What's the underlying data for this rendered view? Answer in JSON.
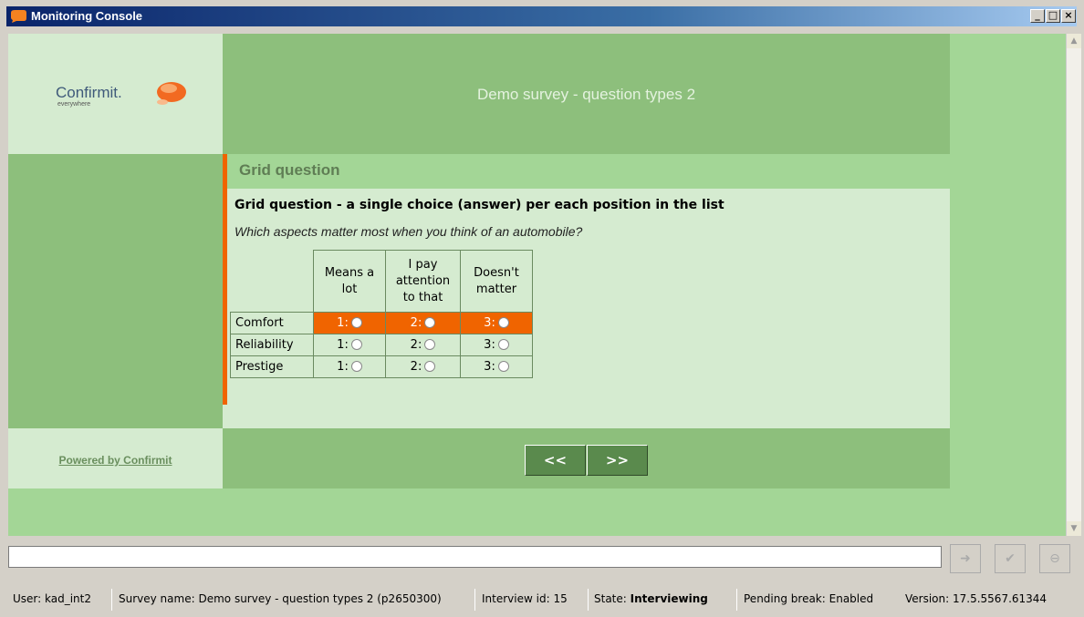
{
  "window": {
    "title": "Monitoring Console",
    "min_label": "_",
    "max_label": "□",
    "close_label": "×"
  },
  "survey": {
    "title": "Demo survey - question types 2",
    "logo_name": "Confirmit.",
    "logo_sub": "everywhere",
    "powered_by": "Powered by Confirmit",
    "question_heading": "Grid question",
    "question_text": "Grid question - a single choice (answer) per each position in the list",
    "question_instruction": "Which aspects matter most when you think of an automobile?",
    "columns": [
      "Means a lot",
      "I pay attention to that",
      "Doesn't matter"
    ],
    "rows": [
      {
        "label": "Comfort",
        "opts": [
          "1:",
          "2:",
          "3:"
        ],
        "highlighted": true
      },
      {
        "label": "Reliability",
        "opts": [
          "1:",
          "2:",
          "3:"
        ],
        "highlighted": false
      },
      {
        "label": "Prestige",
        "opts": [
          "1:",
          "2:",
          "3:"
        ],
        "highlighted": false
      }
    ],
    "prev_label": "<<",
    "next_label": ">>"
  },
  "command": {
    "input_value": ""
  },
  "status": {
    "user_label": "User:",
    "user": "kad_int2",
    "survey_label": "Survey name:",
    "survey_name": "Demo survey - question types 2 (p2650300)",
    "interview_label": "Interview id:",
    "interview_id": "15",
    "state_label": "State:",
    "state": "Interviewing",
    "pending_label": "Pending break:",
    "pending": "Enabled",
    "version_label": "Version:",
    "version": "17.5.5567.61344"
  },
  "colors": {
    "accent": "#f06400",
    "header_green": "#8dbf7c",
    "pale_green": "#d5ebd0",
    "bg_green": "#a3d696"
  }
}
